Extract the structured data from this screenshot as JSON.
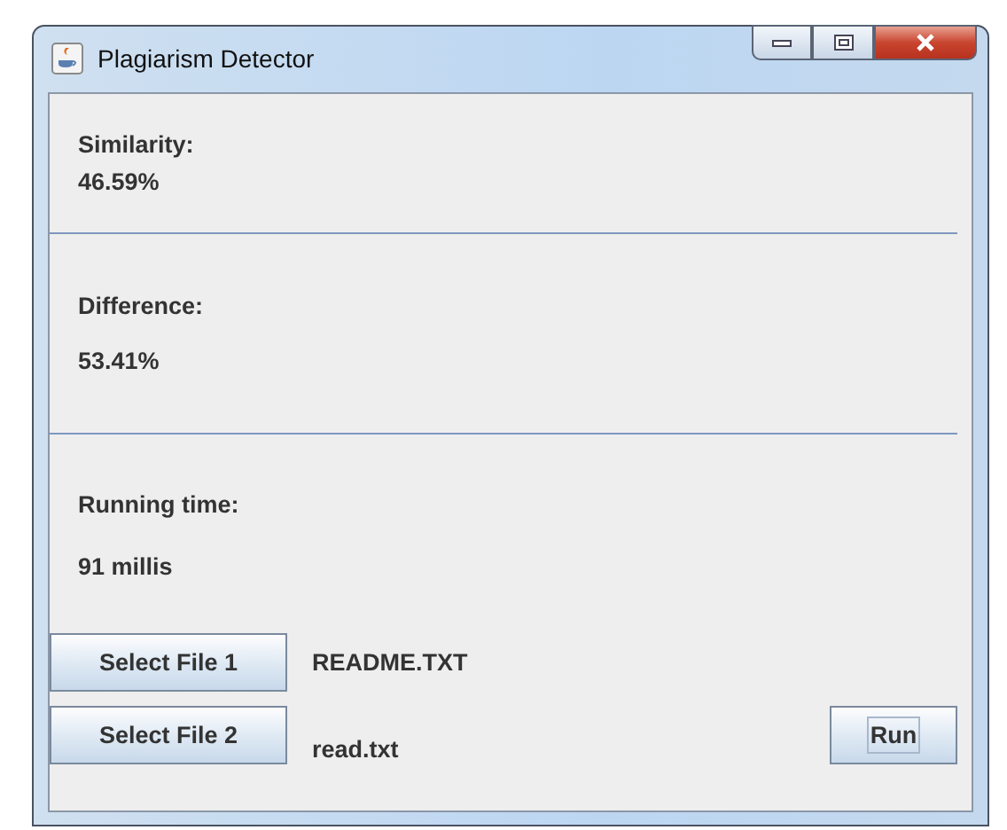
{
  "window": {
    "title": "Plagiarism Detector"
  },
  "results": [
    {
      "label": "Similarity:",
      "value": "46.59%"
    },
    {
      "label": "Difference:",
      "value": "53.41%"
    },
    {
      "label": "Running time:",
      "value": "91 millis"
    }
  ],
  "files": [
    {
      "button": "Select File 1",
      "name": "README.TXT"
    },
    {
      "button": "Select File 2",
      "name": "read.txt"
    }
  ],
  "run_button": "Run"
}
